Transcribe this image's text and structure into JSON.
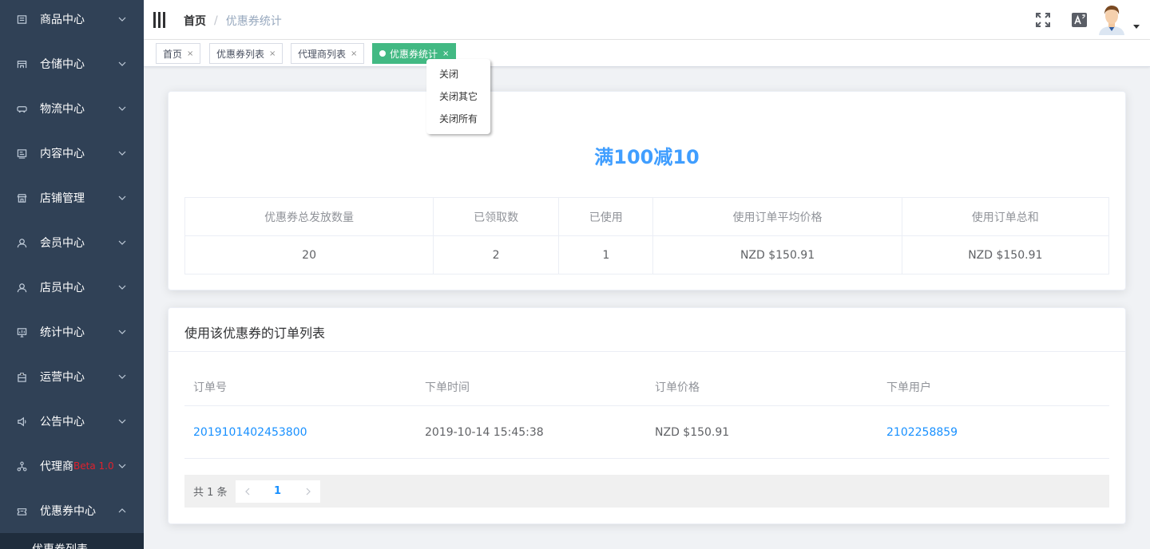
{
  "sidebar": {
    "items": [
      {
        "label": "商品中心",
        "icon": "goods-icon"
      },
      {
        "label": "仓储中心",
        "icon": "warehouse-icon"
      },
      {
        "label": "物流中心",
        "icon": "truck-icon"
      },
      {
        "label": "内容中心",
        "icon": "content-icon"
      },
      {
        "label": "店铺管理",
        "icon": "shop-icon"
      },
      {
        "label": "会员中心",
        "icon": "member-icon"
      },
      {
        "label": "店员中心",
        "icon": "staff-icon"
      },
      {
        "label": "统计中心",
        "icon": "statistics-icon"
      },
      {
        "label": "运营中心",
        "icon": "operations-icon"
      },
      {
        "label": "公告中心",
        "icon": "announcement-icon"
      },
      {
        "label": "代理商",
        "badge": "Beta 1.0",
        "icon": "agent-icon"
      },
      {
        "label": "优惠券中心",
        "icon": "coupon-icon"
      }
    ],
    "submenu_label": "优惠券列表"
  },
  "header": {
    "breadcrumb_home": "首页",
    "breadcrumb_separator": "/",
    "breadcrumb_current": "优惠券统计"
  },
  "tags": [
    {
      "label": "首页",
      "close": "×"
    },
    {
      "label": "优惠券列表",
      "close": "×"
    },
    {
      "label": "代理商列表",
      "close": "×"
    },
    {
      "label": "优惠券统计",
      "close": "×",
      "active": true
    }
  ],
  "context_menu": [
    "关闭",
    "关闭其它",
    "关闭所有"
  ],
  "coupon": {
    "title": "满100减10",
    "stats_headers": [
      "优惠券总发放数量",
      "已领取数",
      "已使用",
      "使用订单平均价格",
      "使用订单总和"
    ],
    "stats_values": [
      "20",
      "2",
      "1",
      "NZD $150.91",
      "NZD $150.91"
    ]
  },
  "orders": {
    "title": "使用该优惠券的订单列表",
    "headers": [
      "订单号",
      "下单时间",
      "订单价格",
      "下单用户"
    ],
    "rows": [
      {
        "order_no": "2019101402453800",
        "time": "2019-10-14 15:45:38",
        "price": "NZD $150.91",
        "user": "2102258859"
      }
    ],
    "total_text": "共 1 条",
    "current_page": "1"
  },
  "colors": {
    "sidebar_bg": "#304156",
    "accent": "#409eff",
    "active_tag": "#42b983",
    "link": "#1890ff"
  }
}
